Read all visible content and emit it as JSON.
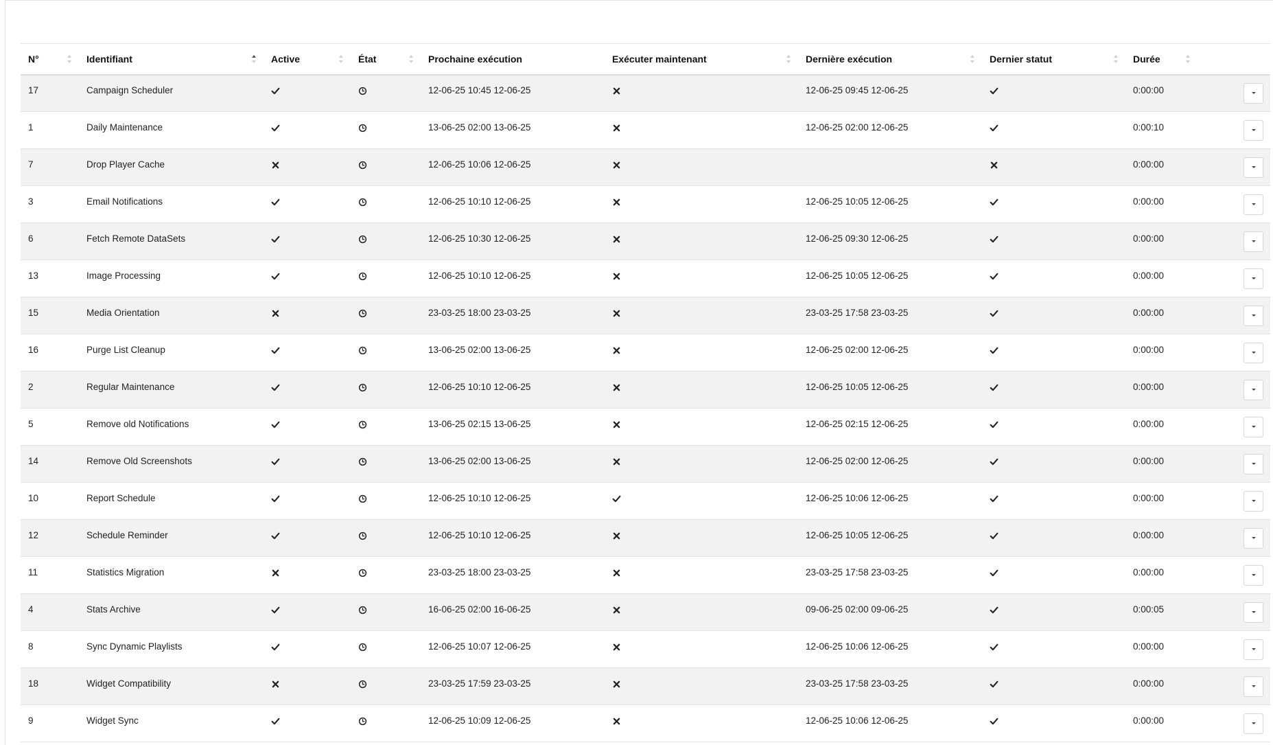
{
  "table": {
    "columns": [
      {
        "label": "N°",
        "sort": "none"
      },
      {
        "label": "Identifiant",
        "sort": "asc"
      },
      {
        "label": "Active",
        "sort": "none"
      },
      {
        "label": "État",
        "sort": "none"
      },
      {
        "label": "Prochaine exécution",
        "sort": "none"
      },
      {
        "label": "Exécuter maintenant",
        "sort": "none"
      },
      {
        "label": "Dernière exécution",
        "sort": "none"
      },
      {
        "label": "Dernier statut",
        "sort": "none"
      },
      {
        "label": "Durée",
        "sort": "none"
      },
      {
        "label": "",
        "sort": "none"
      }
    ],
    "rows": [
      {
        "id": "17",
        "name": "Campaign Scheduler",
        "active": true,
        "state": "clock-icon",
        "next": "12-06-25 10:45 12-06-25",
        "run_now": false,
        "last": "12-06-25 09:45 12-06-25",
        "last_status": true,
        "duration": "0:00:00"
      },
      {
        "id": "1",
        "name": "Daily Maintenance",
        "active": true,
        "state": "clock-icon",
        "next": "13-06-25 02:00 13-06-25",
        "run_now": false,
        "last": "12-06-25 02:00 12-06-25",
        "last_status": true,
        "duration": "0:00:10"
      },
      {
        "id": "7",
        "name": "Drop Player Cache",
        "active": false,
        "state": "clock-icon",
        "next": "12-06-25 10:06 12-06-25",
        "run_now": false,
        "last": "",
        "last_status": false,
        "duration": "0:00:00"
      },
      {
        "id": "3",
        "name": "Email Notifications",
        "active": true,
        "state": "clock-icon",
        "next": "12-06-25 10:10 12-06-25",
        "run_now": false,
        "last": "12-06-25 10:05 12-06-25",
        "last_status": true,
        "duration": "0:00:00"
      },
      {
        "id": "6",
        "name": "Fetch Remote DataSets",
        "active": true,
        "state": "clock-icon",
        "next": "12-06-25 10:30 12-06-25",
        "run_now": false,
        "last": "12-06-25 09:30 12-06-25",
        "last_status": true,
        "duration": "0:00:00"
      },
      {
        "id": "13",
        "name": "Image Processing",
        "active": true,
        "state": "clock-icon",
        "next": "12-06-25 10:10 12-06-25",
        "run_now": false,
        "last": "12-06-25 10:05 12-06-25",
        "last_status": true,
        "duration": "0:00:00"
      },
      {
        "id": "15",
        "name": "Media Orientation",
        "active": false,
        "state": "clock-icon",
        "next": "23-03-25 18:00 23-03-25",
        "run_now": false,
        "last": "23-03-25 17:58 23-03-25",
        "last_status": true,
        "duration": "0:00:00"
      },
      {
        "id": "16",
        "name": "Purge List Cleanup",
        "active": true,
        "state": "clock-icon",
        "next": "13-06-25 02:00 13-06-25",
        "run_now": false,
        "last": "12-06-25 02:00 12-06-25",
        "last_status": true,
        "duration": "0:00:00"
      },
      {
        "id": "2",
        "name": "Regular Maintenance",
        "active": true,
        "state": "clock-icon",
        "next": "12-06-25 10:10 12-06-25",
        "run_now": false,
        "last": "12-06-25 10:05 12-06-25",
        "last_status": true,
        "duration": "0:00:00"
      },
      {
        "id": "5",
        "name": "Remove old Notifications",
        "active": true,
        "state": "clock-icon",
        "next": "13-06-25 02:15 13-06-25",
        "run_now": false,
        "last": "12-06-25 02:15 12-06-25",
        "last_status": true,
        "duration": "0:00:00"
      },
      {
        "id": "14",
        "name": "Remove Old Screenshots",
        "active": true,
        "state": "clock-icon",
        "next": "13-06-25 02:00 13-06-25",
        "run_now": false,
        "last": "12-06-25 02:00 12-06-25",
        "last_status": true,
        "duration": "0:00:00"
      },
      {
        "id": "10",
        "name": "Report Schedule",
        "active": true,
        "state": "clock-icon",
        "next": "12-06-25 10:10 12-06-25",
        "run_now": true,
        "last": "12-06-25 10:06 12-06-25",
        "last_status": true,
        "duration": "0:00:00"
      },
      {
        "id": "12",
        "name": "Schedule Reminder",
        "active": true,
        "state": "clock-icon",
        "next": "12-06-25 10:10 12-06-25",
        "run_now": false,
        "last": "12-06-25 10:05 12-06-25",
        "last_status": true,
        "duration": "0:00:00"
      },
      {
        "id": "11",
        "name": "Statistics Migration",
        "active": false,
        "state": "clock-icon",
        "next": "23-03-25 18:00 23-03-25",
        "run_now": false,
        "last": "23-03-25 17:58 23-03-25",
        "last_status": true,
        "duration": "0:00:00"
      },
      {
        "id": "4",
        "name": "Stats Archive",
        "active": true,
        "state": "clock-icon",
        "next": "16-06-25 02:00 16-06-25",
        "run_now": false,
        "last": "09-06-25 02:00 09-06-25",
        "last_status": true,
        "duration": "0:00:05"
      },
      {
        "id": "8",
        "name": "Sync Dynamic Playlists",
        "active": true,
        "state": "clock-icon",
        "next": "12-06-25 10:07 12-06-25",
        "run_now": false,
        "last": "12-06-25 10:06 12-06-25",
        "last_status": true,
        "duration": "0:00:00"
      },
      {
        "id": "18",
        "name": "Widget Compatibility",
        "active": false,
        "state": "clock-icon",
        "next": "23-03-25 17:59 23-03-25",
        "run_now": false,
        "last": "23-03-25 17:58 23-03-25",
        "last_status": true,
        "duration": "0:00:00"
      },
      {
        "id": "9",
        "name": "Widget Sync",
        "active": true,
        "state": "clock-icon",
        "next": "12-06-25 10:09 12-06-25",
        "run_now": false,
        "last": "12-06-25 10:06 12-06-25",
        "last_status": true,
        "duration": "0:00:00"
      }
    ]
  },
  "icons": {
    "true": "check-icon",
    "false": "cross-icon",
    "state": "clock-icon",
    "row_action": "caret-down-icon"
  },
  "colors": {
    "row_stripe": "#f2f2f2",
    "border": "#e3e3e3",
    "text": "#222222"
  }
}
